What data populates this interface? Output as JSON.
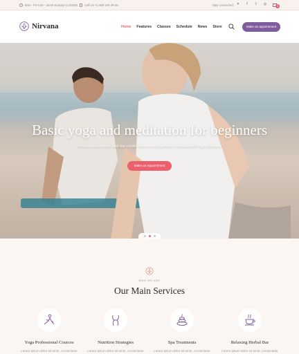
{
  "topbar": {
    "hours": "Mon - Fri 6.00 - 18.00 Sunday CLOSED",
    "phone": "Call Us +1 800 245 39 25",
    "stay_connected": "Stay connected:",
    "social": [
      "twitter-icon",
      "facebook-icon",
      "tumblr-icon",
      "instagram-icon"
    ],
    "cart_count": "0"
  },
  "header": {
    "logo_text": "Nirvana",
    "nav": [
      "Home",
      "Features",
      "Classes",
      "Schedule",
      "News",
      "Store"
    ],
    "active_nav": "Home",
    "appointment_button": "Make an appointment"
  },
  "hero": {
    "title": "Basic yoga and meditation for beginners",
    "subtitle": "You are welcome to visit our center where every person is treated with high attention",
    "button": "Make an Appointment",
    "slides": 3,
    "active_slide": 2
  },
  "services": {
    "eyebrow": "WHO WE ARE",
    "title": "Our Main Services",
    "items": [
      {
        "name": "Yoga Professional Cources",
        "desc": "Lorem ipsum dolor sit amet, consectetur",
        "icon": "yoga-pose-icon"
      },
      {
        "name": "Nutrition Strategies",
        "desc": "Lorem ipsum dolor sit amet, consectetur",
        "icon": "body-nutrition-icon"
      },
      {
        "name": "Spa Treatments",
        "desc": "Lorem ipsum dolor sit amet, consectetur",
        "icon": "spa-stones-icon"
      },
      {
        "name": "Relaxing Herbal Bar",
        "desc": "Lorem ipsum dolor sit amet, consectetur",
        "icon": "tea-cup-icon"
      }
    ]
  },
  "colors": {
    "accent_pink": "#ec5f6e",
    "accent_purple": "#7f5d9c",
    "background": "#fbf6f2"
  }
}
